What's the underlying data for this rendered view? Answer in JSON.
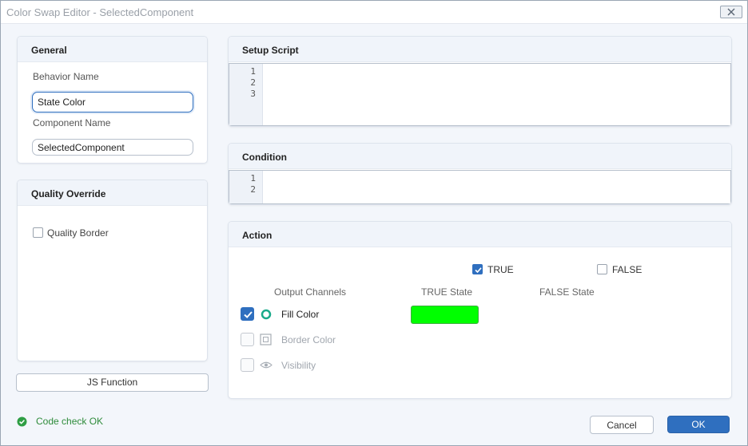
{
  "window": {
    "title": "Color Swap Editor - SelectedComponent"
  },
  "general": {
    "title": "General",
    "behavior_name_label": "Behavior Name",
    "behavior_name_value": "State Color",
    "component_name_label": "Component Name",
    "component_name_value": "SelectedComponent"
  },
  "quality_override": {
    "title": "Quality Override",
    "quality_border_label": "Quality Border",
    "quality_border_checked": false
  },
  "js_function_label": "JS Function",
  "setup_script": {
    "title": "Setup Script",
    "line_numbers": [
      "1",
      "2",
      "3"
    ]
  },
  "condition": {
    "title": "Condition",
    "line_numbers": [
      "1",
      "2"
    ]
  },
  "action": {
    "title": "Action",
    "true_label": "TRUE",
    "true_checked": true,
    "false_label": "FALSE",
    "false_checked": false,
    "col_output_channels": "Output Channels",
    "col_true_state": "TRUE State",
    "col_false_state": "FALSE State",
    "channels": [
      {
        "label": "Fill Color",
        "icon": "fill-circle-icon",
        "checked": true,
        "enabled": true,
        "true_color": "#00ff00"
      },
      {
        "label": "Border Color",
        "icon": "border-square-icon",
        "checked": false,
        "enabled": false
      },
      {
        "label": "Visibility",
        "icon": "eye-icon",
        "checked": false,
        "enabled": false
      }
    ]
  },
  "status": {
    "text": "Code check OK",
    "icon": "check-circle-icon",
    "color": "#2e8b3a"
  },
  "buttons": {
    "cancel": "Cancel",
    "ok": "OK"
  },
  "colors": {
    "accent": "#2f6fbf",
    "teal": "#1aaa8a",
    "fill_true": "#00ff00"
  }
}
